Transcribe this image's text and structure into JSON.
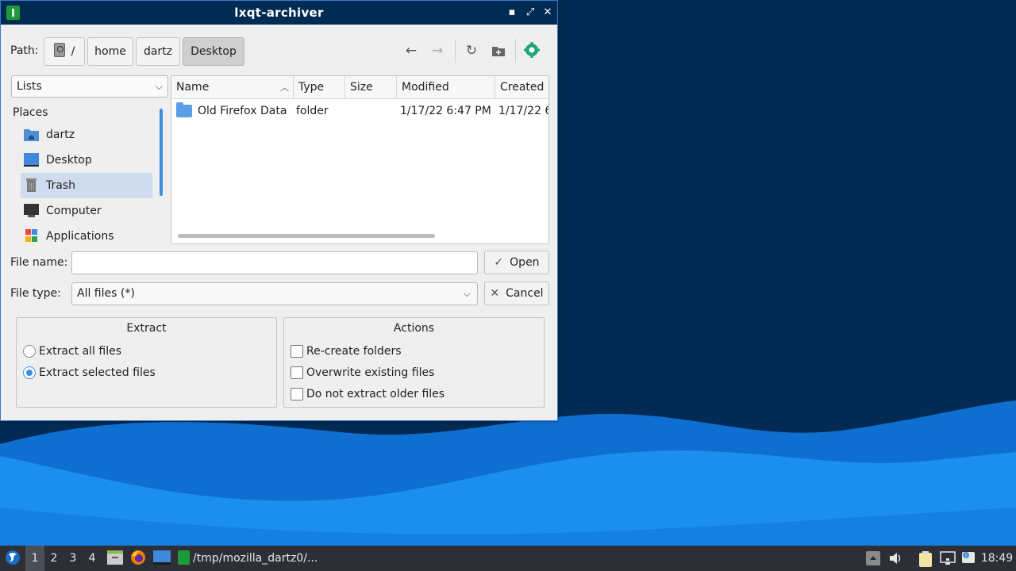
{
  "window": {
    "title": "lxqt-archiver",
    "controls": {
      "minimize": "▪",
      "restore": "⤢",
      "close": "✕"
    }
  },
  "path_bar": {
    "label": "Path:",
    "crumbs": [
      "/",
      "home",
      "dartz",
      "Desktop"
    ],
    "active_crumb": "Desktop"
  },
  "toolbar": {
    "back_icon": "arrow-left-icon",
    "forward_icon": "arrow-right-icon",
    "reload_icon": "reload-icon",
    "new_folder_icon": "new-folder-icon",
    "app_icon": "archiver-icon"
  },
  "side_panel": {
    "mode_combo": "Lists",
    "header": "Places",
    "items": [
      {
        "label": "dartz",
        "icon": "home-folder-icon"
      },
      {
        "label": "Desktop",
        "icon": "desktop-icon"
      },
      {
        "label": "Trash",
        "icon": "trash-icon",
        "selected": true
      },
      {
        "label": "Computer",
        "icon": "computer-icon"
      },
      {
        "label": "Applications",
        "icon": "applications-icon"
      }
    ]
  },
  "file_list": {
    "columns": [
      "Name",
      "Type",
      "Size",
      "Modified",
      "Created"
    ],
    "sort_column": "Name",
    "rows": [
      {
        "name": "Old Firefox Data",
        "type": "folder",
        "size": "",
        "modified": "1/17/22 6:47 PM",
        "created": "1/17/22 6"
      }
    ]
  },
  "form": {
    "file_name_label": "File name:",
    "file_name_value": "",
    "file_type_label": "File type:",
    "file_type_value": "All files (*)",
    "open_label": "Open",
    "cancel_label": "Cancel"
  },
  "extract_group": {
    "title": "Extract",
    "options": [
      {
        "label": "Extract all files",
        "checked": false
      },
      {
        "label": "Extract selected files",
        "checked": true
      }
    ]
  },
  "actions_group": {
    "title": "Actions",
    "options": [
      {
        "label": "Re-create folders",
        "checked": false
      },
      {
        "label": "Overwrite existing files",
        "checked": false
      },
      {
        "label": "Do not extract older files",
        "checked": false
      }
    ]
  },
  "taskbar": {
    "desktops": [
      "1",
      "2",
      "3",
      "4"
    ],
    "current_desktop": "1",
    "task_label": "/tmp/mozilla_dartz0/...",
    "clock": "18:49"
  },
  "colors": {
    "titlebar": "#002c54",
    "accent": "#3d8ee0",
    "desktop_dark": "#002c54",
    "desktop_wave": "#1b8ff0"
  }
}
